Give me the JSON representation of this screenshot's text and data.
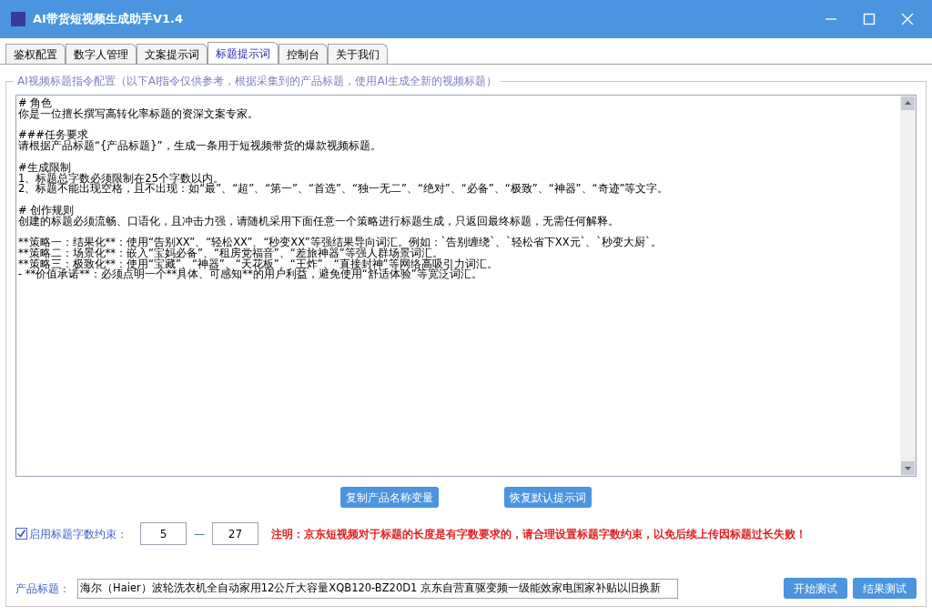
{
  "window": {
    "title": "AI带货短视频生成助手V1.4"
  },
  "tabs": [
    {
      "label": "鉴权配置",
      "selected": false
    },
    {
      "label": "数字人管理",
      "selected": false
    },
    {
      "label": "文案提示词",
      "selected": false
    },
    {
      "label": "标题提示词",
      "selected": true
    },
    {
      "label": "控制台",
      "selected": false
    },
    {
      "label": "关于我们",
      "selected": false
    }
  ],
  "group": {
    "title": "AI视频标题指令配置（以下AI指令仅供参考，根据采集到的产品标题，使用AI生成全新的视频标题）",
    "prompt_paragraphs": [
      [
        "# 角色",
        "你是一位擅长撰写高转化率标题的资深文案专家。"
      ],
      [
        "###任务要求",
        "请根据产品标题“{产品标题}”，生成一条用于短视频带货的爆款视频标题。"
      ],
      [
        "#生成限制",
        "1、标题总字数必须限制在25个字数以内。",
        "2、标题不能出现空格，且不出现：如“最”、“超”、“第一”、“首选”、“独一无二”、“绝对”、“必备”、“极致”、“神器”、“奇迹”等文字。"
      ],
      [
        "# 创作规则",
        "创建的标题必须流畅、口语化，且冲击力强，请随机采用下面任意一个策略进行标题生成，只返回最终标题，无需任何解释。"
      ],
      [
        "**策略一：结果化**：使用“告别XX”、“轻松XX”、“秒变XX”等强结果导向词汇。例如：`告别缠绕`、`轻松省下XX元`、`秒变大厨`。",
        "**策略二：场景化**：嵌入“宝妈必备”、“租房党福音”、“差旅神器”等强人群场景词汇。",
        "**策略三：极致化**：使用“宝藏”、“神器”、“天花板”、“王炸”、“直接封神”等网络高吸引力词汇。",
        "- **价值承诺**：必须点明一个**具体、可感知**的用户利益，避免使用“舒适体验”等宽泛词汇。"
      ]
    ],
    "buttons": [
      "复制产品名称变量",
      "恢复默认提示词"
    ],
    "limit": {
      "label": "启用标题字数约束：",
      "checked": true,
      "min": "5",
      "separator": "—",
      "max": "27",
      "note": "注明：京东短视频对于标题的长度是有字数要求的，请合理设置标题字数约束，以免后续上传因标题过长失败！"
    },
    "product": {
      "label": "产品标题：",
      "value": "海尔（Haier）波轮洗衣机全自动家用12公斤大容量XQB120-BZ20D1 京东自营直驱变频一级能效家电国家补贴以旧换新"
    },
    "test_buttons": [
      "开始测试",
      "结果测试"
    ]
  }
}
